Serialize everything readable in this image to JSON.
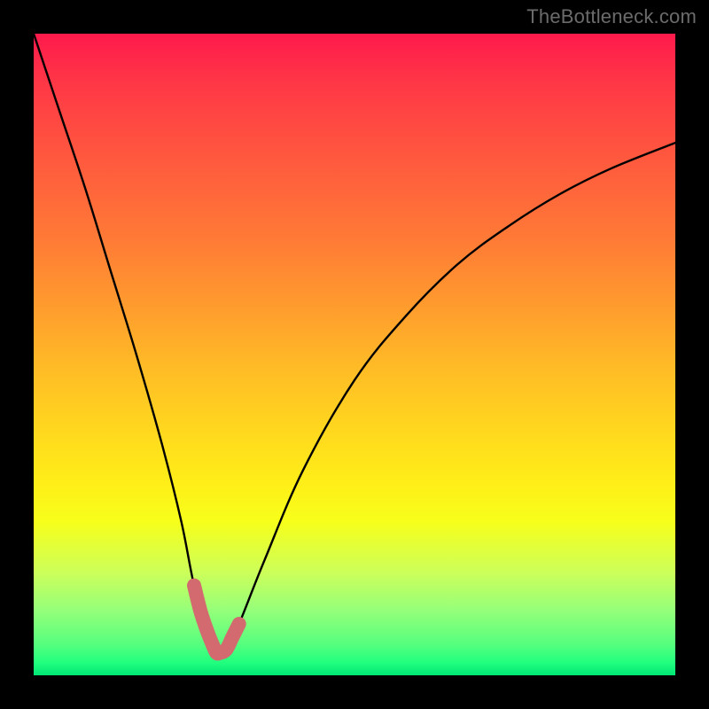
{
  "watermark": "TheBottleneck.com",
  "colors": {
    "frame": "#000000",
    "gradient_top": "#ff1a4c",
    "gradient_bottom": "#00e676",
    "curve": "#000000",
    "marker": "#d26a6f"
  },
  "chart_data": {
    "type": "line",
    "title": "",
    "xlabel": "",
    "ylabel": "",
    "xlim": [
      0,
      100
    ],
    "ylim": [
      0,
      100
    ],
    "grid": false,
    "legend": false,
    "annotations": [],
    "series": [
      {
        "name": "bottleneck-curve",
        "x": [
          0,
          4,
          8,
          12,
          16,
          20,
          23,
          25,
          27,
          28.5,
          30,
          32,
          36,
          42,
          50,
          58,
          66,
          74,
          82,
          90,
          100
        ],
        "values": [
          100,
          88,
          76,
          63,
          50,
          36,
          24,
          14,
          7,
          3.5,
          4,
          8,
          18,
          32,
          46,
          56,
          64,
          70,
          75,
          79,
          83
        ]
      },
      {
        "name": "optimal-marker",
        "x": [
          25,
          26,
          27,
          28,
          28.5,
          29,
          30,
          31,
          32
        ],
        "values": [
          14,
          10,
          7,
          4.5,
          3.5,
          3.5,
          4,
          6,
          8
        ]
      }
    ]
  }
}
